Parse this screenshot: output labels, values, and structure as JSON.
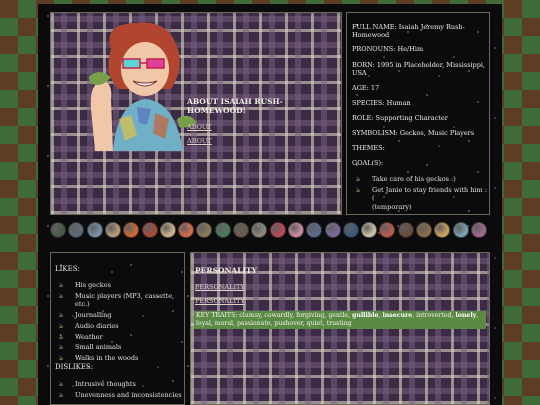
{
  "about": {
    "title_line1": "ABOUT ISAIAH RUSH-",
    "title_line2": "HOMEWOOD!",
    "link1": "ABOUT",
    "link2": "ABOUT"
  },
  "profile": {
    "full_name_line1": "FULL NAME: Isaiah Jeremy Rush-",
    "full_name_line2": "Homewood",
    "pronouns": "PRONOUNS: He/Him",
    "born_line1": "BORN: 1995 in Placeholder, Mississippi,",
    "born_line2": "USA",
    "age": "AGE: 17",
    "species": "SPECIES: Human",
    "role": "ROLE: Supporting Character",
    "symbolism": "SYMBOLISM: Geckos, Music Players",
    "themes": "THEMES:",
    "goals_label": "GOAL(S):",
    "goals": [
      "Take care of his geckos :)",
      "Get Janie to stay friends with him :(",
      "(temporary)"
    ]
  },
  "likes": {
    "label": "LIKES:",
    "items": [
      "His geckos",
      "Music players (MP3, cassette, etc.)",
      "Journalling",
      "Audio diaries",
      "Weather",
      "Small animals",
      "Walks in the woods"
    ]
  },
  "dislikes": {
    "label": "DISLIKES:",
    "items": [
      "Intrusive thoughts",
      "Unevenness and inconsistencies"
    ]
  },
  "personality": {
    "heading": "PERSONALITY",
    "link1": "PERSONALITY",
    "link2": "PERSONALITY",
    "traits_prefix": "KEY TRAITS: clumsy, cowardly, forgiving, gentle, ",
    "trait_bold1": "gullible",
    "traits_mid1": ", ",
    "trait_bold2": "insecure",
    "traits_mid2": ", introverted, ",
    "trait_bold3": "lonely",
    "traits_mid3": ",",
    "traits_line2": "loyal, moral, passionate, pushover, quiet, trusting"
  },
  "icons": {
    "gecko": "gecko-icon",
    "button_colors": [
      "#4a5a4a",
      "#5c6b78",
      "#7a8fa8",
      "#b59a7a",
      "#c96a3a",
      "#a84a3a",
      "#c9b38a",
      "#d06a4a",
      "#8a7a5a",
      "#4a7a5a",
      "#6a5a4a",
      "#8a8a7a",
      "#b84a5a",
      "#c98aa0",
      "#5a6a8a",
      "#7a6a9a",
      "#3a5a7a",
      "#c9c0a8",
      "#b85a4a",
      "#6a4a3a",
      "#8a6a4a",
      "#c9a060",
      "#7aa0b0",
      "#a06a8a"
    ]
  }
}
